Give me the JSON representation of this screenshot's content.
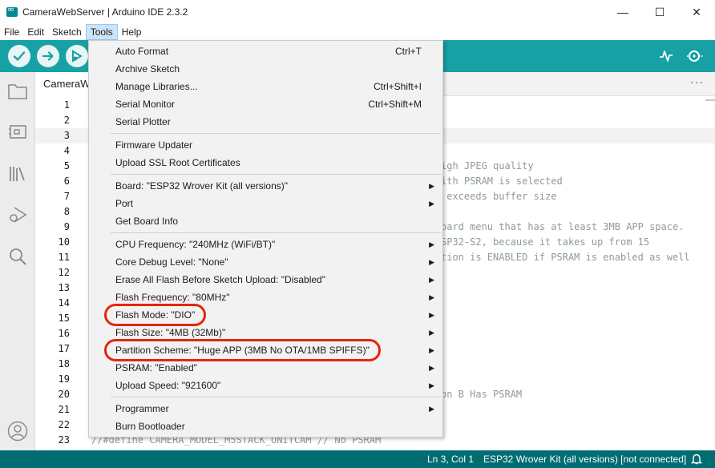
{
  "window": {
    "title": "CameraWebServer | Arduino IDE 2.3.2",
    "controls": {
      "minimize": "—",
      "maximize": "☐",
      "close": "✕"
    }
  },
  "menubar": [
    "File",
    "Edit",
    "Sketch",
    "Tools",
    "Help"
  ],
  "toolbar": {
    "buttons": [
      "verify-icon",
      "upload-icon",
      "debug-icon"
    ],
    "right_buttons": [
      "serial-plotter-icon",
      "serial-monitor-icon"
    ]
  },
  "sidebar": {
    "icons": [
      "folder-icon",
      "board-manager-icon",
      "library-icon",
      "debug-icon",
      "search-icon",
      "profile-icon"
    ]
  },
  "editor": {
    "tab": "CameraWebServer.ino",
    "tab_visible": "CameraWe",
    "more": "···",
    "line_numbers": [
      "1",
      "2",
      "3",
      "4",
      "5",
      "6",
      "7",
      "8",
      "9",
      "10",
      "11",
      "12",
      "13",
      "14",
      "15",
      "16",
      "17",
      "18",
      "19",
      "20",
      "21",
      "22",
      "23"
    ],
    "visible_code": [
      {
        "line": 5,
        "text": "igh JPEG quality"
      },
      {
        "line": 6,
        "text": "ith PSRAM is selected"
      },
      {
        "line": 7,
        "text": " exceeds buffer size"
      },
      {
        "line": 9,
        "text": "oard menu that has at least 3MB APP space."
      },
      {
        "line": 10,
        "text": "SP32-S2, because it takes up from 15"
      },
      {
        "line": 11,
        "text": "tion is ENABLED if PSRAM is enabled as well"
      },
      {
        "line": 20,
        "text": "on B Has PSRAM"
      },
      {
        "line": 23,
        "text": "//#define CAMERA_MODEL_M5STACK_UNITCAM // No PSRAM"
      }
    ]
  },
  "tools_menu": {
    "groups": [
      [
        {
          "label": "Auto Format",
          "shortcut": "Ctrl+T"
        },
        {
          "label": "Archive Sketch"
        },
        {
          "label": "Manage Libraries...",
          "shortcut": "Ctrl+Shift+I"
        },
        {
          "label": "Serial Monitor",
          "shortcut": "Ctrl+Shift+M"
        },
        {
          "label": "Serial Plotter"
        }
      ],
      [
        {
          "label": "Firmware Updater"
        },
        {
          "label": "Upload SSL Root Certificates"
        }
      ],
      [
        {
          "label": "Board: \"ESP32 Wrover Kit (all versions)\"",
          "submenu": true
        },
        {
          "label": "Port",
          "submenu": true
        },
        {
          "label": "Get Board Info"
        }
      ],
      [
        {
          "label": "CPU Frequency: \"240MHz (WiFi/BT)\"",
          "submenu": true
        },
        {
          "label": "Core Debug Level: \"None\"",
          "submenu": true
        },
        {
          "label": "Erase All Flash Before Sketch Upload: \"Disabled\"",
          "submenu": true
        },
        {
          "label": "Flash Frequency: \"80MHz\"",
          "submenu": true
        },
        {
          "label": "Flash Mode: \"DIO\"",
          "submenu": true,
          "highlighted": true
        },
        {
          "label": "Flash Size: \"4MB (32Mb)\"",
          "submenu": true
        },
        {
          "label": "Partition Scheme: \"Huge APP (3MB No OTA/1MB SPIFFS)\"",
          "submenu": true,
          "highlighted": true
        },
        {
          "label": "PSRAM: \"Enabled\"",
          "submenu": true
        },
        {
          "label": "Upload Speed: \"921600\"",
          "submenu": true
        }
      ],
      [
        {
          "label": "Programmer",
          "submenu": true
        },
        {
          "label": "Burn Bootloader"
        }
      ]
    ],
    "submenu_arrow": "▶",
    "highlight_color": "#e3260e"
  },
  "statusbar": {
    "cursor": "Ln 3, Col 1",
    "board": "ESP32 Wrover Kit (all versions) [not connected]",
    "bell": "bell-icon"
  },
  "colors": {
    "toolbar": "#17a1a5",
    "statusbar": "#006d73",
    "annotation": "#e3260e"
  }
}
